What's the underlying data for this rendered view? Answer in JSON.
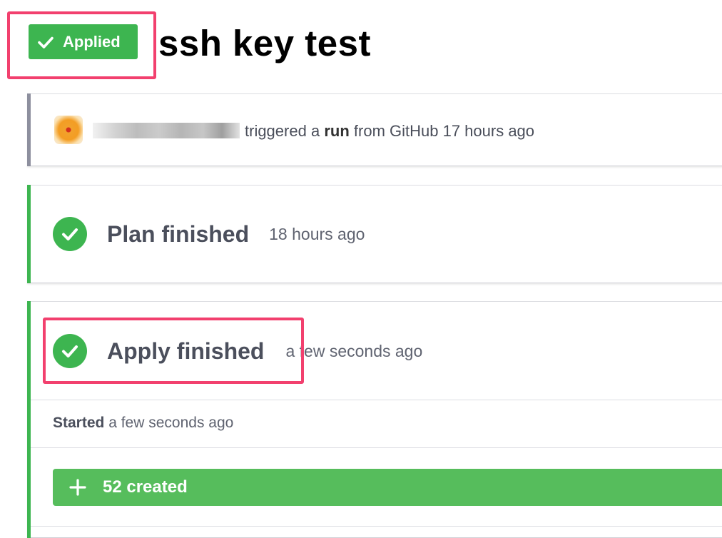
{
  "header": {
    "status_badge": "Applied",
    "run_title": "ssh key test"
  },
  "trigger": {
    "user_name": "",
    "text_prefix": "triggered a",
    "link_text": "run",
    "text_suffix": "from GitHub 17 hours ago"
  },
  "plan": {
    "title": "Plan finished",
    "time": "18 hours ago"
  },
  "apply": {
    "title": "Apply finished",
    "time": "a few seconds ago",
    "started_label": "Started",
    "started_time": "a few seconds ago",
    "created_summary": "52 created"
  },
  "colors": {
    "success_green": "#3db550",
    "created_bar_green": "#56bd5c",
    "highlight_pink": "#f2406e",
    "card_neutral_border": "#8d8f9e"
  },
  "icons": {
    "badge": "check-icon",
    "plan_status": "check-circle-icon",
    "apply_status": "check-circle-icon",
    "created": "plus-icon"
  }
}
